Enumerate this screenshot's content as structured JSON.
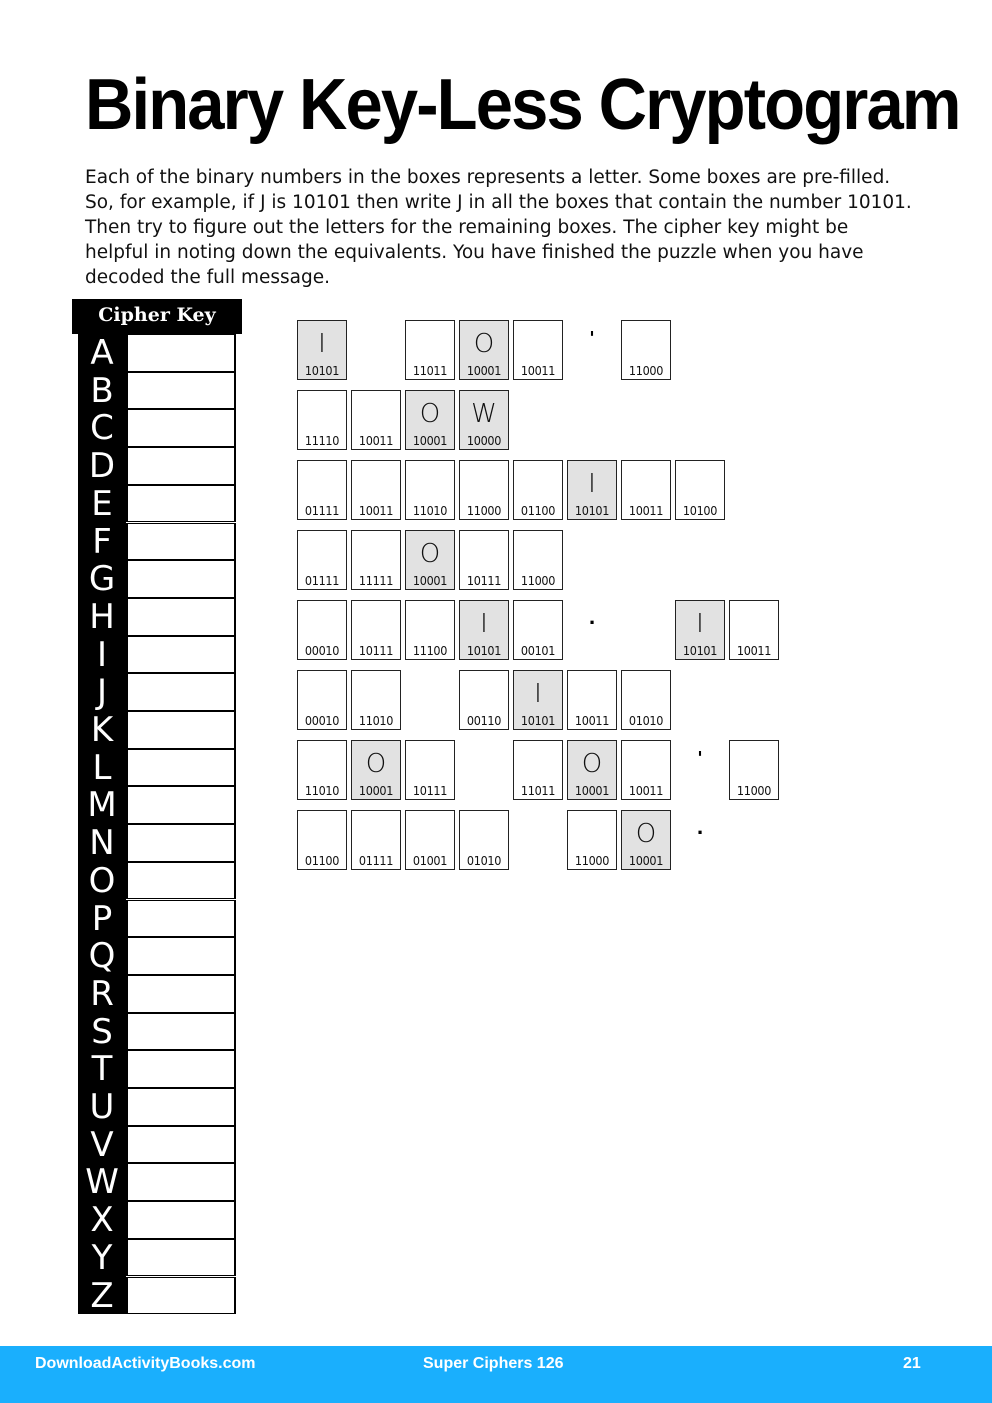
{
  "title": "Binary Key-Less Cryptogram",
  "instructions": "Each of the binary numbers in the boxes represents a letter. Some boxes are pre-filled. So, for example, if J is 10101 then write J in all the boxes that contain the number 10101. Then try to figure out the letters for the remaining boxes. The cipher key might be helpful in noting down the equivalents. You have finished the puzzle when you have decoded the full message.",
  "cipher_key": {
    "header": "Cipher Key",
    "letters": [
      "A",
      "B",
      "C",
      "D",
      "E",
      "F",
      "G",
      "H",
      "I",
      "J",
      "K",
      "L",
      "M",
      "N",
      "O",
      "P",
      "Q",
      "R",
      "S",
      "T",
      "U",
      "V",
      "W",
      "X",
      "Y",
      "Z"
    ]
  },
  "puzzle_rows": [
    [
      {
        "col": 0,
        "code": "10101",
        "letter": "I"
      },
      {
        "col": 2,
        "code": "11011",
        "letter": ""
      },
      {
        "col": 3,
        "code": "10001",
        "letter": "O"
      },
      {
        "col": 4,
        "code": "10011",
        "letter": ""
      },
      {
        "col": 5,
        "punct": "'"
      },
      {
        "col": 6,
        "code": "11000",
        "letter": ""
      }
    ],
    [
      {
        "col": 0,
        "code": "11110",
        "letter": ""
      },
      {
        "col": 1,
        "code": "10011",
        "letter": ""
      },
      {
        "col": 2,
        "code": "10001",
        "letter": "O"
      },
      {
        "col": 3,
        "code": "10000",
        "letter": "W"
      }
    ],
    [
      {
        "col": 0,
        "code": "01111",
        "letter": ""
      },
      {
        "col": 1,
        "code": "10011",
        "letter": ""
      },
      {
        "col": 2,
        "code": "11010",
        "letter": ""
      },
      {
        "col": 3,
        "code": "11000",
        "letter": ""
      },
      {
        "col": 4,
        "code": "01100",
        "letter": ""
      },
      {
        "col": 5,
        "code": "10101",
        "letter": "I"
      },
      {
        "col": 6,
        "code": "10011",
        "letter": ""
      },
      {
        "col": 7,
        "code": "10100",
        "letter": ""
      }
    ],
    [
      {
        "col": 0,
        "code": "01111",
        "letter": ""
      },
      {
        "col": 1,
        "code": "11111",
        "letter": ""
      },
      {
        "col": 2,
        "code": "10001",
        "letter": "O"
      },
      {
        "col": 3,
        "code": "10111",
        "letter": ""
      },
      {
        "col": 4,
        "code": "11000",
        "letter": ""
      }
    ],
    [
      {
        "col": 0,
        "code": "00010",
        "letter": ""
      },
      {
        "col": 1,
        "code": "10111",
        "letter": ""
      },
      {
        "col": 2,
        "code": "11100",
        "letter": ""
      },
      {
        "col": 3,
        "code": "10101",
        "letter": "I"
      },
      {
        "col": 4,
        "code": "00101",
        "letter": ""
      },
      {
        "col": 5,
        "punct": "."
      },
      {
        "col": 7,
        "code": "10101",
        "letter": "I"
      },
      {
        "col": 8,
        "code": "10011",
        "letter": ""
      }
    ],
    [
      {
        "col": 0,
        "code": "00010",
        "letter": ""
      },
      {
        "col": 1,
        "code": "11010",
        "letter": ""
      },
      {
        "col": 3,
        "code": "00110",
        "letter": ""
      },
      {
        "col": 4,
        "code": "10101",
        "letter": "I"
      },
      {
        "col": 5,
        "code": "10011",
        "letter": ""
      },
      {
        "col": 6,
        "code": "01010",
        "letter": ""
      }
    ],
    [
      {
        "col": 0,
        "code": "11010",
        "letter": ""
      },
      {
        "col": 1,
        "code": "10001",
        "letter": "O"
      },
      {
        "col": 2,
        "code": "10111",
        "letter": ""
      },
      {
        "col": 4,
        "code": "11011",
        "letter": ""
      },
      {
        "col": 5,
        "code": "10001",
        "letter": "O"
      },
      {
        "col": 6,
        "code": "10011",
        "letter": ""
      },
      {
        "col": 7,
        "punct": "'"
      },
      {
        "col": 8,
        "code": "11000",
        "letter": ""
      }
    ],
    [
      {
        "col": 0,
        "code": "01100",
        "letter": ""
      },
      {
        "col": 1,
        "code": "01111",
        "letter": ""
      },
      {
        "col": 2,
        "code": "01001",
        "letter": ""
      },
      {
        "col": 3,
        "code": "01010",
        "letter": ""
      },
      {
        "col": 5,
        "code": "11000",
        "letter": ""
      },
      {
        "col": 6,
        "code": "10001",
        "letter": "O"
      },
      {
        "col": 7,
        "punct": "."
      }
    ]
  ],
  "footer": {
    "site": "DownloadActivityBooks.com",
    "book": "Super Ciphers 126",
    "page": "21"
  }
}
